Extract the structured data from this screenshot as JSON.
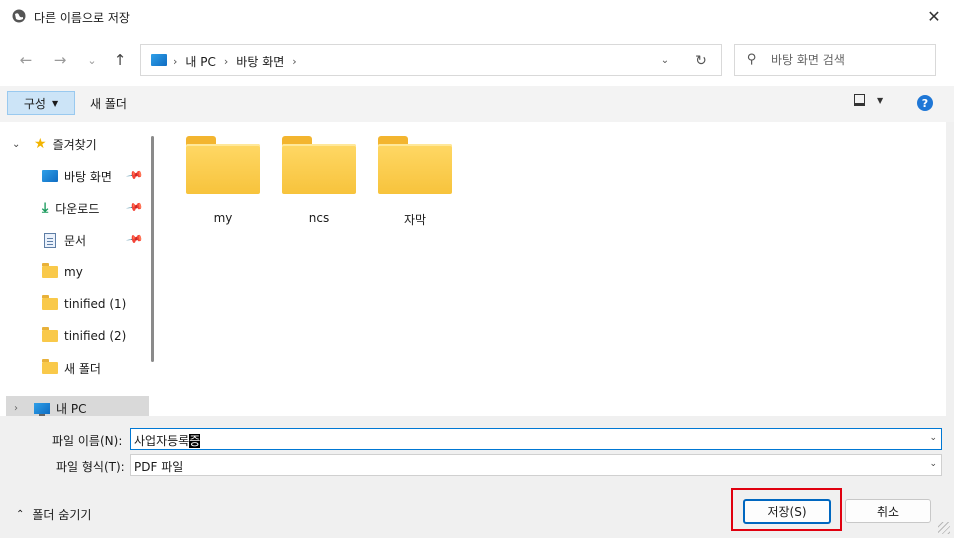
{
  "window": {
    "title": "다른 이름으로 저장",
    "close": "✕"
  },
  "nav": {
    "back": "←",
    "forward": "→",
    "recent": "⌄",
    "up": "↑",
    "breadcrumbs": [
      "내 PC",
      "바탕 화면"
    ],
    "crumb_sep": "›",
    "dropdown": "⌄",
    "refresh": "↻"
  },
  "search": {
    "placeholder": "바탕 화면 검색"
  },
  "toolbar": {
    "organize": "구성",
    "new_folder": "새 폴더",
    "help": "?"
  },
  "sidebar": {
    "quick_access": "즐겨찾기",
    "items": [
      {
        "label": "바탕 화면",
        "icon": "desktop-icon",
        "pinned": true
      },
      {
        "label": "다운로드",
        "icon": "download-icon",
        "pinned": true
      },
      {
        "label": "문서",
        "icon": "document-icon",
        "pinned": true
      },
      {
        "label": "my",
        "icon": "folder-icon",
        "pinned": false
      },
      {
        "label": "tinified (1)",
        "icon": "folder-icon",
        "pinned": false
      },
      {
        "label": "tinified (2)",
        "icon": "folder-icon",
        "pinned": false
      },
      {
        "label": "새 폴더",
        "icon": "folder-icon",
        "pinned": false
      }
    ],
    "this_pc": "내 PC"
  },
  "content": {
    "folders": [
      "my",
      "ncs",
      "자막"
    ]
  },
  "form": {
    "filename_label": "파일 이름(N):",
    "filename_value": "사업자등록",
    "filename_selected": "증",
    "filetype_label": "파일 형식(T):",
    "filetype_value": "PDF 파일"
  },
  "footer": {
    "hide_folders": "폴더 숨기기",
    "save": "저장(S)",
    "cancel": "취소"
  },
  "colors": {
    "accent": "#0067c0",
    "highlight": "#e0000f",
    "organize_bg": "#cce4f7"
  }
}
